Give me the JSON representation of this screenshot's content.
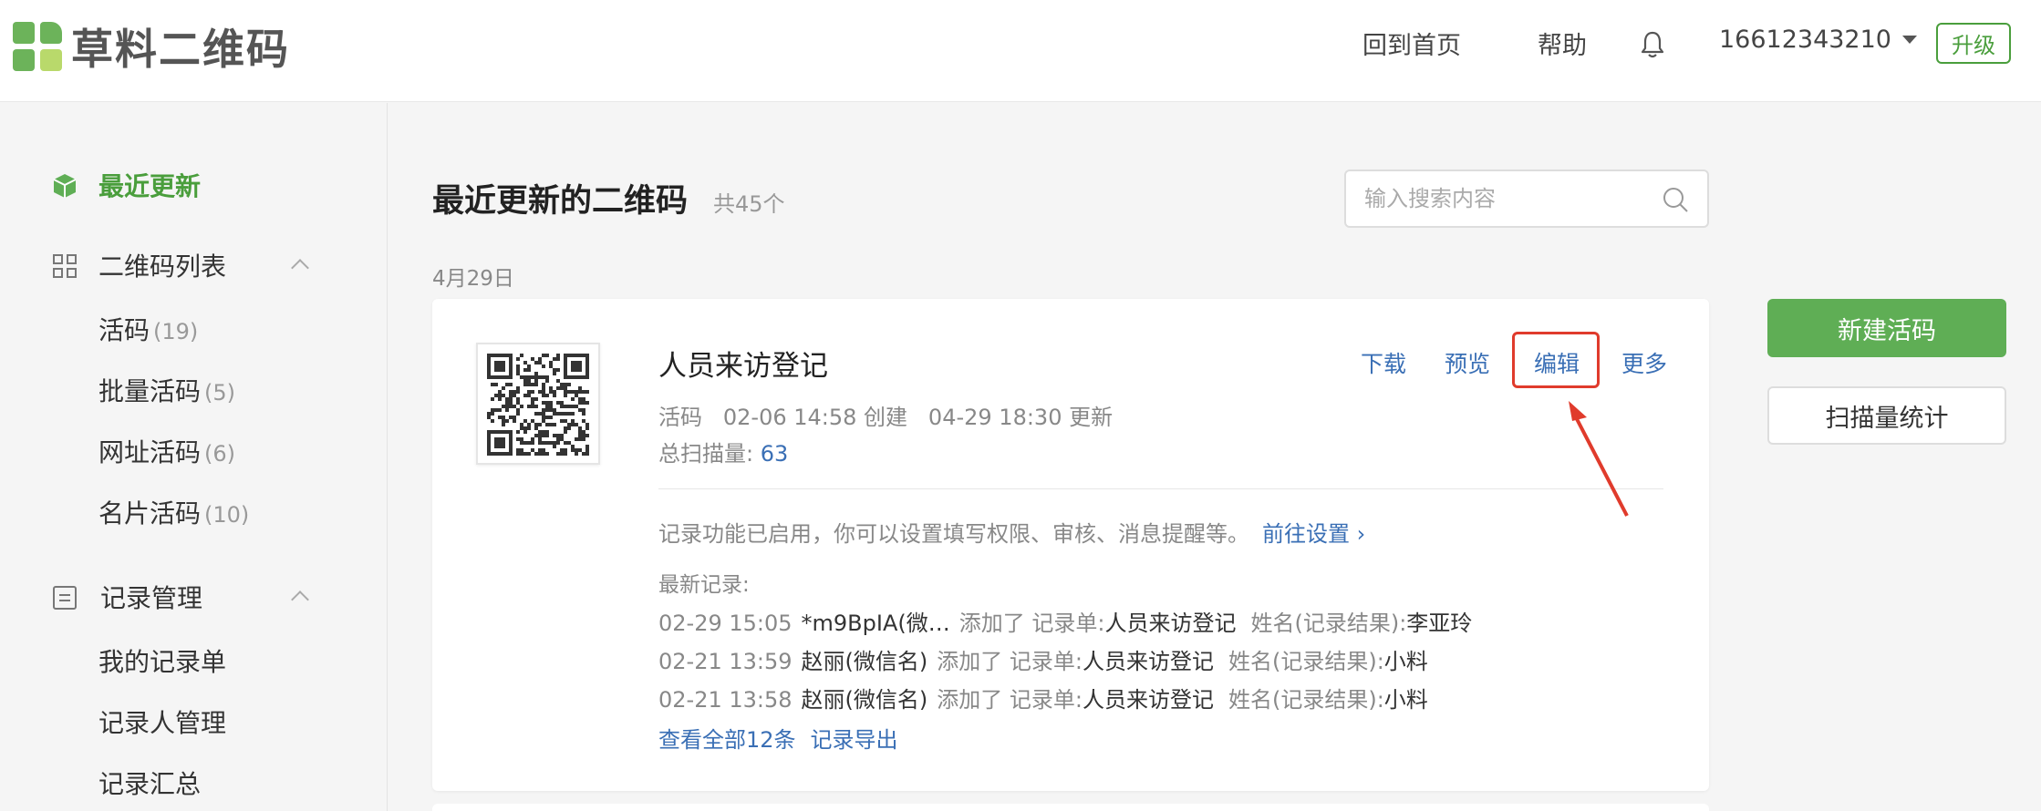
{
  "header": {
    "brand": "草料二维码",
    "nav_home": "回到首页",
    "nav_help": "帮助",
    "bell_icon": "bell-icon",
    "user_phone": "16612343210",
    "upgrade_label": "升级"
  },
  "sidebar": {
    "recent": "最近更新",
    "qr_list": {
      "label": "二维码列表",
      "items": [
        {
          "label": "活码",
          "count": "(19)"
        },
        {
          "label": "批量活码",
          "count": "(5)"
        },
        {
          "label": "网址活码",
          "count": "(6)"
        },
        {
          "label": "名片活码",
          "count": "(10)"
        }
      ]
    },
    "records": {
      "label": "记录管理",
      "items": [
        {
          "label": "我的记录单"
        },
        {
          "label": "记录人管理"
        },
        {
          "label": "记录汇总"
        }
      ]
    }
  },
  "main": {
    "title": "最近更新的二维码",
    "total": "共45个",
    "search_placeholder": "输入搜索内容",
    "date_group": "4月29日"
  },
  "card": {
    "title": "人员来访登记",
    "actions": {
      "download": "下载",
      "preview": "预览",
      "edit": "编辑",
      "more": "更多"
    },
    "meta": "活码   02-06 14:58 创建   04-29 18:30 更新",
    "scan_label": "总扫描量:",
    "scan_count": "63",
    "notice": "记录功能已启用，你可以设置填写权限、审核、消息提醒等。",
    "notice_link": "前往设置 ›",
    "latest_label": "最新记录:",
    "records": [
      {
        "time": "02-29 15:05",
        "user": "*m9BpIA(微…",
        "added": "添加了 记录单:",
        "form": "人员来访登记",
        "key": "姓名(记录结果):",
        "value": "李亚玲"
      },
      {
        "time": "02-21 13:59",
        "user": "赵丽(微信名)",
        "added": "添加了 记录单:",
        "form": "人员来访登记",
        "key": "姓名(记录结果):",
        "value": "小料"
      },
      {
        "time": "02-21 13:58",
        "user": "赵丽(微信名)",
        "added": "添加了 记录单:",
        "form": "人员来访登记",
        "key": "姓名(记录结果):",
        "value": "小料"
      }
    ],
    "view_all": "查看全部12条",
    "export": "记录导出"
  },
  "right": {
    "new_button": "新建活码",
    "stats_button": "扫描量统计"
  },
  "colors": {
    "brand_green": "#5fae55",
    "link_blue": "#3a6fb5",
    "highlight_red": "#e03b2c"
  }
}
